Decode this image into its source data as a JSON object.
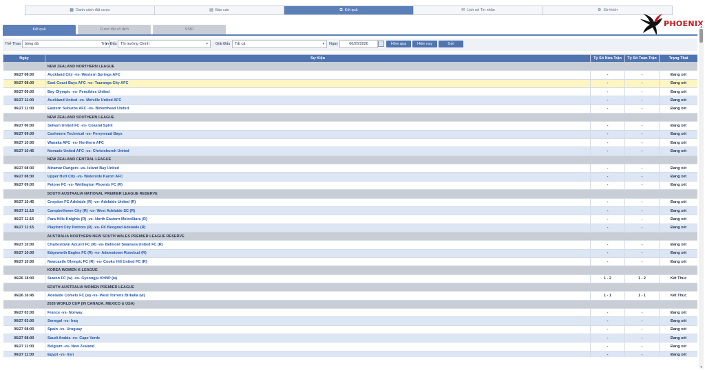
{
  "topnav": [
    {
      "label": "Danh sách đặt cược",
      "icon": "calendar-icon",
      "active": false
    },
    {
      "label": "Báo cáo",
      "icon": "report-icon",
      "active": false
    },
    {
      "label": "Kết quả",
      "icon": "result-icon",
      "active": true
    },
    {
      "label": "Lịch sử Tin nhắn",
      "icon": "message-icon",
      "active": false
    },
    {
      "label": "Sở thích",
      "icon": "gear-icon",
      "active": false
    }
  ],
  "logo": {
    "text": "PHOENIX",
    "color": "#c0191f"
  },
  "subtabs": [
    {
      "label": "Kết quả",
      "active": true
    },
    {
      "label": "Cược đội vô địch",
      "active": false
    },
    {
      "label": "SSID",
      "active": false
    }
  ],
  "filters": {
    "sport_label": "Thể Thao",
    "sport_value": "bóng đá",
    "match_label": "Trận Đấu",
    "match_value": "Thị trường Chính",
    "league_label": "Giải Đấu",
    "league_value": "Tất cả",
    "date_label": "Ngày",
    "date_value": "06/26/2026",
    "btn_yesterday": "Hôm qua",
    "btn_today": "Hôm nay",
    "btn_submit": "Gửi"
  },
  "table": {
    "headers": [
      "Ngày",
      "Sự Kiện",
      "Tỷ Số Nửa Trận",
      "Tỷ Số Toàn Trận",
      "Trạng Thái"
    ],
    "rows": [
      {
        "type": "league",
        "name": "NEW ZEALAND NORTHERN LEAGUE"
      },
      {
        "date": "06/27 08:00",
        "event": "Auckland City -vs- Western Springs AFC",
        "half": "-",
        "full": "-",
        "status": "Đang xét"
      },
      {
        "date": "06/27 08:00",
        "event": "East Coast Bays AFC -vs- Tauranga City AFC",
        "half": "-",
        "full": "-",
        "status": "Đang xét",
        "highlight": true
      },
      {
        "date": "06/27 09:00",
        "event": "Bay Olympic -vs- Fencibles United",
        "half": "-",
        "full": "-",
        "status": "Đang xét"
      },
      {
        "date": "06/27 11:00",
        "event": "Auckland United -vs- Melville United AFC",
        "half": "-",
        "full": "-",
        "status": "Đang xét"
      },
      {
        "date": "06/27 11:00",
        "event": "Eastern Suburbs AFC -vs- Birkenhead United",
        "half": "-",
        "full": "-",
        "status": "Đang xét"
      },
      {
        "type": "league",
        "name": "NEW ZEALAND SOUTHERN LEAGUE"
      },
      {
        "date": "06/27 06:00",
        "event": "Selwyn United FC -vs- Coastal Spirit",
        "half": "-",
        "full": "-",
        "status": "Đang xét"
      },
      {
        "date": "06/27 09:00",
        "event": "Cashmere Technical -vs- Ferrymead Bays",
        "half": "-",
        "full": "-",
        "status": "Đang xét"
      },
      {
        "date": "06/27 10:00",
        "event": "Wanaka AFC -vs- Northern AFC",
        "half": "-",
        "full": "-",
        "status": "Đang xét"
      },
      {
        "date": "06/27 10:45",
        "event": "Nomads United AFC -vs- Christchurch United",
        "half": "-",
        "full": "-",
        "status": "Đang xét"
      },
      {
        "type": "league",
        "name": "NEW ZEALAND CENTRAL LEAGUE"
      },
      {
        "date": "06/27 08:30",
        "event": "Miramar Rangers -vs- Island Bay United",
        "half": "-",
        "full": "-",
        "status": "Đang xét"
      },
      {
        "date": "06/27 08:30",
        "event": "Upper Hutt City -vs- Waterside Karori AFC",
        "half": "-",
        "full": "-",
        "status": "Đang xét"
      },
      {
        "date": "06/27 09:00",
        "event": "Petone FC -vs- Wellington Phoenix FC (R)",
        "half": "-",
        "full": "-",
        "status": "Đang xét"
      },
      {
        "type": "league",
        "name": "SOUTH AUSTRALIA NATIONAL PREMIER LEAGUE RESERVE"
      },
      {
        "date": "06/27 10:45",
        "event": "Croydon FC Adelaide (R) -vs- Adelaide United (R)",
        "half": "-",
        "full": "-",
        "status": "Đang xét"
      },
      {
        "date": "06/27 11:15",
        "event": "Campbelltown City (R) -vs- West Adelaide SC (R)",
        "half": "-",
        "full": "-",
        "status": "Đang xét"
      },
      {
        "date": "06/27 11:15",
        "event": "Para Hills Knights (R) -vs- North Eastern MetroStars (R)",
        "half": "-",
        "full": "-",
        "status": "Đang xét"
      },
      {
        "date": "06/27 11:15",
        "event": "Playford City Patriots (R) -vs- FK Beograd Adelaide (R)",
        "half": "-",
        "full": "-",
        "status": "Đang xét"
      },
      {
        "type": "league",
        "name": "AUSTRALIA NORTHERN NEW SOUTH WALES PREMIER LEAGUE RESERVE"
      },
      {
        "date": "06/27 10:00",
        "event": "Charlestown Azzurri FC (R) -vs- Belmont Swansea United FC (R)",
        "half": "-",
        "full": "-",
        "status": "Đang xét"
      },
      {
        "date": "06/27 10:00",
        "event": "Edgeworth Eagles FC (R) -vs- Adamstown Rosebud (R)",
        "half": "-",
        "full": "-",
        "status": "Đang xét"
      },
      {
        "date": "06/27 10:00",
        "event": "Newcastle Olympic FC (R) -vs- Cooks Hill United FC (R)",
        "half": "-",
        "full": "-",
        "status": "Đang xét"
      },
      {
        "type": "league",
        "name": "KOREA WOMEN K-LEAGUE"
      },
      {
        "date": "06/26 18:00",
        "event": "Suwon FC (w) -vs- Gyeongju KHNP (w)",
        "half": "1 - 2",
        "full": "1 - 2",
        "status": "Kết Thúc"
      },
      {
        "type": "league",
        "name": "SOUTH AUSTRALIA WOMEN PREMIER LEAGUE"
      },
      {
        "date": "06/26 16:45",
        "event": "Adelaide Comets FC (w) -vs- West Torrens Birkalla (w)",
        "half": "1 - 1",
        "full": "1 - 1",
        "status": "Kết Thúc"
      },
      {
        "type": "league",
        "name": "2026 WORLD CUP (IN CANADA, MEXICO & USA)"
      },
      {
        "date": "06/27 03:00",
        "event": "France -vs- Norway",
        "half": "-",
        "full": "-",
        "status": "Đang xét"
      },
      {
        "date": "06/27 03:00",
        "event": "Senegal -vs- Iraq",
        "half": "-",
        "full": "-",
        "status": "Đang xét"
      },
      {
        "date": "06/27 08:00",
        "event": "Spain -vs- Uruguay",
        "half": "-",
        "full": "-",
        "status": "Đang xét"
      },
      {
        "date": "06/27 08:00",
        "event": "Saudi Arabia -vs- Cape Verde",
        "half": "-",
        "full": "-",
        "status": "Đang xét"
      },
      {
        "date": "06/27 11:00",
        "event": "Belgium -vs- New Zealand",
        "half": "-",
        "full": "-",
        "status": "Đang xét"
      },
      {
        "date": "06/27 11:00",
        "event": "Egypt -vs- Iran",
        "half": "-",
        "full": "-",
        "status": "Đang xét"
      }
    ]
  },
  "colors": {
    "accent": "#5b7fb8",
    "header": "#4f74b0",
    "league_row": "#c9ced6",
    "alt_row": "#dce6f4",
    "highlight_row": "#fdf6c2"
  }
}
